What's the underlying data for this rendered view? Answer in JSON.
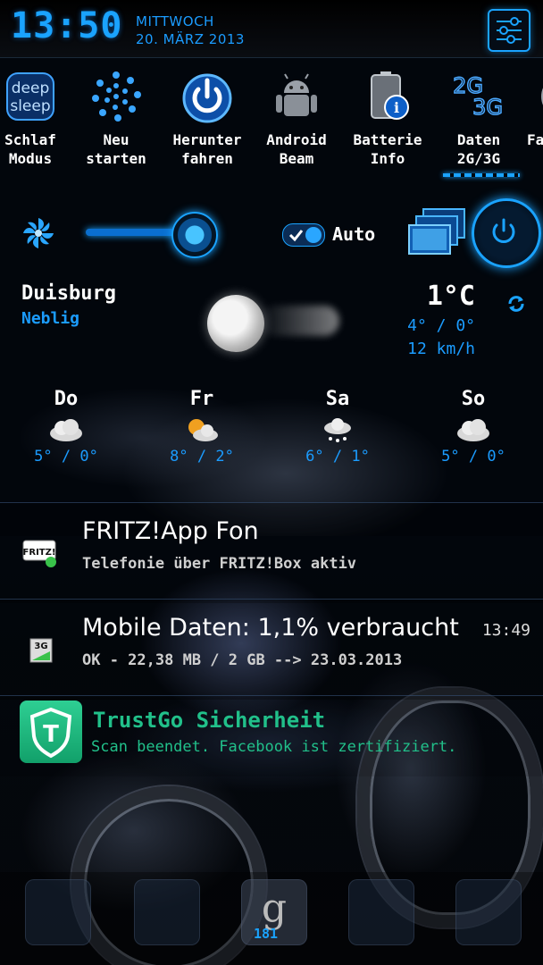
{
  "statusbar": {
    "time": "13:50",
    "weekday": "MITTWOCH",
    "date": "20. MÄRZ 2013"
  },
  "toggles": [
    {
      "label_line1": "Schlaf",
      "label_line2": "Modus",
      "icon": "deep-sleep-icon",
      "icon_text1": "deep",
      "icon_text2": "sleep"
    },
    {
      "label_line1": "Neu",
      "label_line2": "starten",
      "icon": "restart-icon"
    },
    {
      "label_line1": "Herunter",
      "label_line2": "fahren",
      "icon": "shutdown-icon"
    },
    {
      "label_line1": "Android",
      "label_line2": "Beam",
      "icon": "android-beam-icon"
    },
    {
      "label_line1": "Batterie",
      "label_line2": "Info",
      "icon": "battery-info-icon"
    },
    {
      "label_line1": "Daten",
      "label_line2": "2G/3G",
      "icon": "data-2g3g-icon",
      "icon_text1": "2G",
      "icon_text2": "3G"
    },
    {
      "label_line1": "Fa",
      "label_line2": "",
      "icon": "partial-toggle-icon"
    }
  ],
  "brightness": {
    "level": 0.75,
    "auto_label": "Auto"
  },
  "weather": {
    "city": "Duisburg",
    "condition": "Neblig",
    "temperature": "1°C",
    "high_low": "4° / 0°",
    "wind": "12 km/h",
    "forecast": [
      {
        "day": "Do",
        "temps": "5° / 0°",
        "icon": "cloudy-icon"
      },
      {
        "day": "Fr",
        "temps": "8° / 2°",
        "icon": "partly-sunny-icon"
      },
      {
        "day": "Sa",
        "temps": "6° / 1°",
        "icon": "snow-cloud-icon"
      },
      {
        "day": "So",
        "temps": "5° / 0°",
        "icon": "cloudy-icon"
      }
    ]
  },
  "notifications": [
    {
      "title": "FRITZ!App Fon",
      "subtitle": "Telefonie über FRITZ!Box aktiv",
      "time": "",
      "icon_text": "FRITZ!"
    },
    {
      "title": "Mobile Daten: 1,1% verbraucht",
      "subtitle": "OK - 22,38 MB / 2 GB --> 23.03.2013",
      "time": "13:49",
      "icon_text": "3G"
    }
  ],
  "trustgo": {
    "title": "TrustGo Sicherheit",
    "subtitle": "Scan beendet. Facebook ist zertifiziert.",
    "icon_letter": "T"
  },
  "dock": {
    "count": "181",
    "google_letter": "g"
  }
}
